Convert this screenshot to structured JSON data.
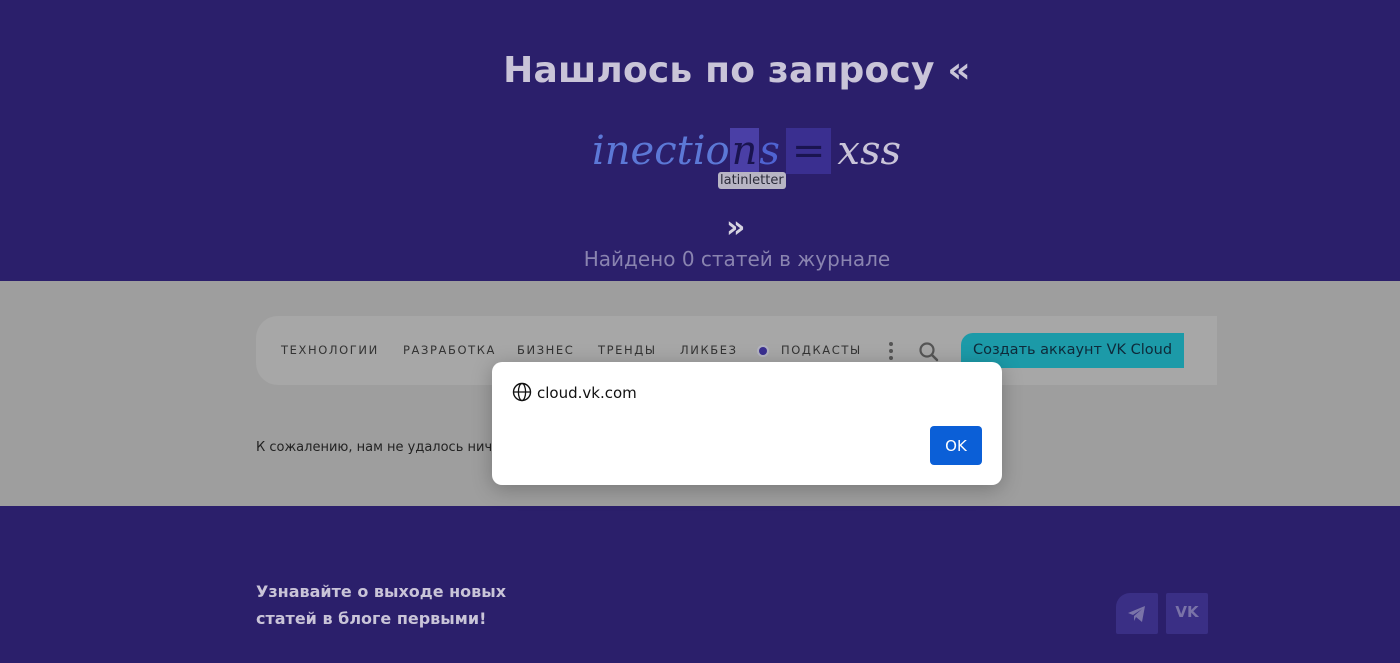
{
  "hero": {
    "title": "Нашлось по запросу «",
    "math": {
      "part1": "inectio",
      "part2": "n",
      "part3": "s",
      "part4": "=",
      "part5": "xss"
    },
    "tooltip": "latinletter",
    "quote_close": "»",
    "found": "Найдено 0 статей в журнале"
  },
  "nav": {
    "items": [
      "ТЕХНОЛОГИИ",
      "РАЗРАБОТКА",
      "БИЗНЕС",
      "ТРЕНДЫ",
      "ЛИКБЕЗ",
      "ПОДКАСТЫ"
    ],
    "cta": "Создать аккаунт VK Cloud"
  },
  "main": {
    "sorry": "К сожалению, нам не удалось ничего"
  },
  "footer": {
    "subscribe_line1": "Узнавайте о выходе новых",
    "subscribe_line2": "статей в блоге первыми!",
    "vk_label": "VK"
  },
  "dialog": {
    "origin": "cloud.vk.com",
    "ok": "OK"
  },
  "colors": {
    "brand_dark": "#2b1f6b",
    "cta": "#1c9aa8",
    "ok_button": "#0b5fd7"
  },
  "icons": [
    "globe-icon",
    "search-icon",
    "kebab-menu-icon",
    "telegram-icon",
    "vk-icon",
    "podcast-dot-icon"
  ]
}
